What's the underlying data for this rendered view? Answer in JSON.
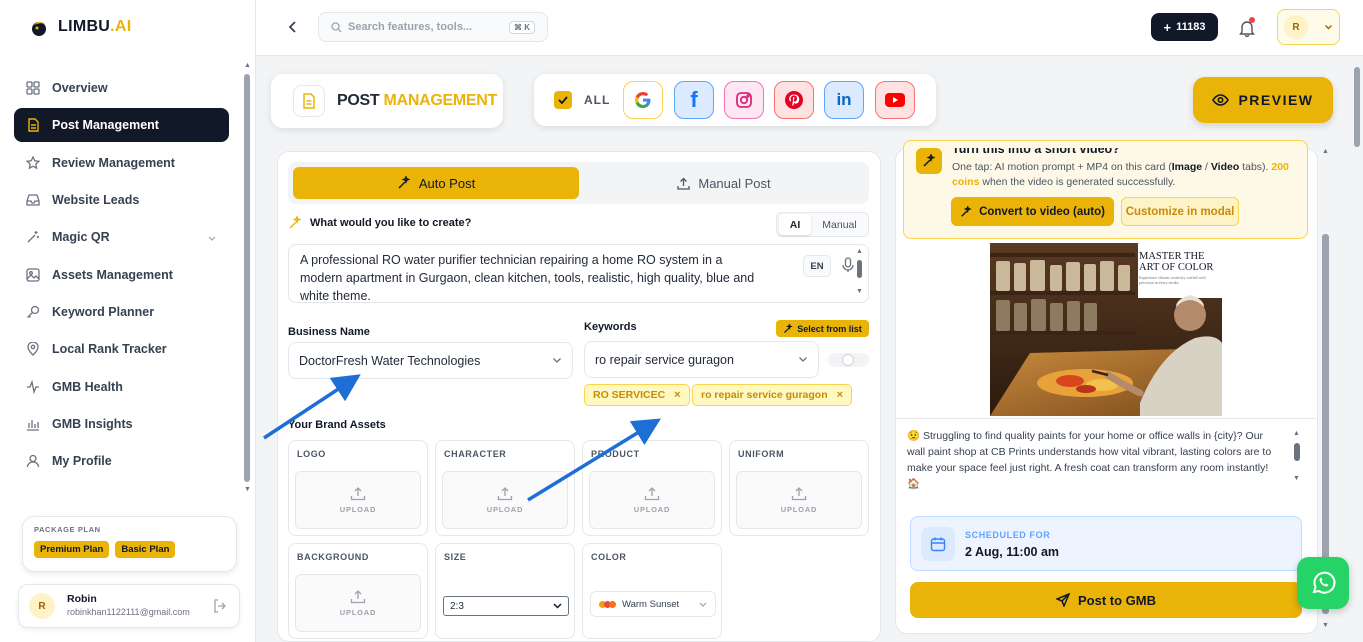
{
  "app": {
    "name": "LIMBU",
    "name_suffix": ".AI"
  },
  "sidebar": {
    "items": [
      {
        "label": "Overview",
        "icon": "grid-icon"
      },
      {
        "label": "Post Management",
        "icon": "document-icon",
        "active": true
      },
      {
        "label": "Review Management",
        "icon": "star-icon"
      },
      {
        "label": "Website Leads",
        "icon": "inbox-icon"
      },
      {
        "label": "Magic QR",
        "icon": "wand-icon"
      },
      {
        "label": "Assets Management",
        "icon": "image-icon"
      },
      {
        "label": "Keyword Planner",
        "icon": "key-icon"
      },
      {
        "label": "Local Rank Tracker",
        "icon": "pin-icon"
      },
      {
        "label": "GMB Health",
        "icon": "pulse-icon"
      },
      {
        "label": "GMB Insights",
        "icon": "bar-chart-icon"
      },
      {
        "label": "My Profile",
        "icon": "user-icon"
      }
    ],
    "package": {
      "title": "PACKAGE PLAN",
      "plans": [
        "Premium Plan",
        "Basic Plan"
      ]
    },
    "user": {
      "initial": "R",
      "name": "Robin",
      "email": "robinkhan1122111@gmail.com"
    }
  },
  "topbar": {
    "search_placeholder": "Search features, tools...",
    "shortcut": "⌘ K",
    "coins": "11183",
    "profile_initial": "R"
  },
  "header": {
    "title_part1": "POST",
    "title_part2": "MANAGEMENT",
    "all_label": "ALL",
    "platforms": [
      "google",
      "facebook",
      "instagram",
      "pinterest",
      "linkedin",
      "youtube"
    ],
    "preview_label": "PREVIEW"
  },
  "form": {
    "tab_auto": "Auto Post",
    "tab_manual": "Manual Post",
    "question": "What would you like to create?",
    "mode_ai": "AI",
    "mode_manual": "Manual",
    "prompt": "A professional RO water purifier technician repairing a home RO system in a modern apartment in Gurgaon, clean kitchen, tools, realistic, high quality, blue and white theme.",
    "lang": "EN",
    "business_label": "Business Name",
    "business_value": "DoctorFresh Water Technologies",
    "keywords_label": "Keywords",
    "select_from_list": "Select from list",
    "keyword_value": "ro repair service guragon",
    "keyword_chips": [
      "RO SERVICEC",
      "ro repair service guragon"
    ],
    "brand_assets_label": "Your Brand Assets",
    "assets": [
      "LOGO",
      "CHARACTER",
      "PRODUCT",
      "UNIFORM",
      "BACKGROUND"
    ],
    "upload_label": "UPLOAD",
    "size_label": "SIZE",
    "size_value": "2:3",
    "color_label": "COLOR",
    "color_value": "Warm Sunset"
  },
  "preview_panel": {
    "video_title": "Turn this into a short video?",
    "video_desc_1": "One tap: AI motion prompt + MP4 on this card (",
    "video_desc_image": "Image",
    "video_desc_sep": " / ",
    "video_desc_video": "Video",
    "video_desc_2": " tabs). ",
    "video_desc_coins": "200 coins",
    "video_desc_3": " when the video is generated successfully.",
    "convert_btn": "Convert to video (auto)",
    "customize_btn": "Customize in modal",
    "image_heading_1": "MASTER THE",
    "image_heading_2": "ART OF COLOR",
    "image_sub": "Experience vibrant creativity crafted with precision in every stroke.",
    "caption": "😟 Struggling to find quality paints for your home or office walls in {city}? Our wall paint shop at CB Prints understands how vital vibrant, lasting colors are to make your space feel just right. A fresh coat can transform any room instantly! 🏠",
    "scheduled_label": "SCHEDULED FOR",
    "scheduled_value": "2 Aug, 11:00 am",
    "post_btn": "Post to GMB"
  },
  "colors": {
    "accent": "#eab308",
    "dark": "#111827",
    "arrow": "#1d6fd6"
  }
}
